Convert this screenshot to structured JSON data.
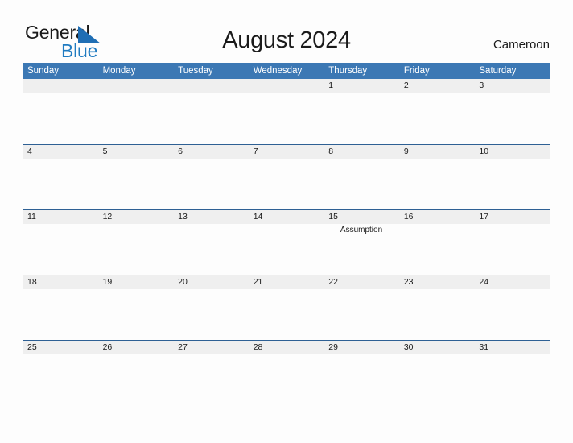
{
  "page": {
    "background_color": "#fdfdfd",
    "accent_color": "#3c78b4",
    "border_color": "#2e6094",
    "band_color": "#efefef",
    "logo_blue": "#1f7bc1"
  },
  "logo": {
    "word_general": "General",
    "word_blue": "Blue",
    "triangle_icon": "blue-right-triangle-icon"
  },
  "header": {
    "title": "August 2024",
    "country": "Cameroon"
  },
  "calendar": {
    "weekdays": [
      "Sunday",
      "Monday",
      "Tuesday",
      "Wednesday",
      "Thursday",
      "Friday",
      "Saturday"
    ],
    "weeks": [
      {
        "days": [
          {
            "date": "",
            "event": ""
          },
          {
            "date": "",
            "event": ""
          },
          {
            "date": "",
            "event": ""
          },
          {
            "date": "",
            "event": ""
          },
          {
            "date": "1",
            "event": ""
          },
          {
            "date": "2",
            "event": ""
          },
          {
            "date": "3",
            "event": ""
          }
        ]
      },
      {
        "days": [
          {
            "date": "4",
            "event": ""
          },
          {
            "date": "5",
            "event": ""
          },
          {
            "date": "6",
            "event": ""
          },
          {
            "date": "7",
            "event": ""
          },
          {
            "date": "8",
            "event": ""
          },
          {
            "date": "9",
            "event": ""
          },
          {
            "date": "10",
            "event": ""
          }
        ]
      },
      {
        "days": [
          {
            "date": "11",
            "event": ""
          },
          {
            "date": "12",
            "event": ""
          },
          {
            "date": "13",
            "event": ""
          },
          {
            "date": "14",
            "event": ""
          },
          {
            "date": "15",
            "event": "Assumption"
          },
          {
            "date": "16",
            "event": ""
          },
          {
            "date": "17",
            "event": ""
          }
        ]
      },
      {
        "days": [
          {
            "date": "18",
            "event": ""
          },
          {
            "date": "19",
            "event": ""
          },
          {
            "date": "20",
            "event": ""
          },
          {
            "date": "21",
            "event": ""
          },
          {
            "date": "22",
            "event": ""
          },
          {
            "date": "23",
            "event": ""
          },
          {
            "date": "24",
            "event": ""
          }
        ]
      },
      {
        "days": [
          {
            "date": "25",
            "event": ""
          },
          {
            "date": "26",
            "event": ""
          },
          {
            "date": "27",
            "event": ""
          },
          {
            "date": "28",
            "event": ""
          },
          {
            "date": "29",
            "event": ""
          },
          {
            "date": "30",
            "event": ""
          },
          {
            "date": "31",
            "event": ""
          }
        ]
      }
    ]
  }
}
